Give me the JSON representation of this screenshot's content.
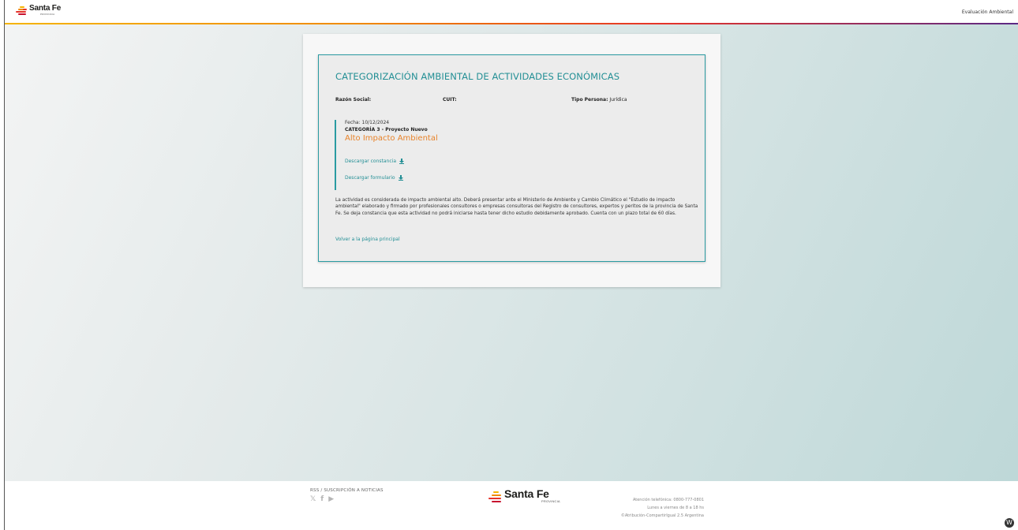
{
  "header": {
    "brand": "Santa Fe",
    "brand_sub": "PROVINCIA",
    "nav_link": "Evaluación Ambiental"
  },
  "main": {
    "title": "CATEGORIZACIÓN AMBIENTAL DE ACTIVIDADES ECONÓMICAS",
    "fields": {
      "razon_social_label": "Razón Social:",
      "razon_social_value": "",
      "cuit_label": "CUIT:",
      "cuit_value": "",
      "tipo_persona_label": "Tipo Persona:",
      "tipo_persona_value": "Jurídica"
    },
    "result": {
      "date": "Fecha: 10/12/2024",
      "category": "CATEGORÍA 3 - Proyecto Nuevo",
      "impact": "Alto Impacto Ambiental",
      "download_constancia": "Descargar constancia",
      "download_formulario": "Descargar formulario"
    },
    "description": "La actividad es considerada de impacto ambiental alto. Deberá presentar ante el Ministerio de Ambiente y Cambio Climático el \"Estudio de impacto ambiental\" elaborado y firmado por profesionales consultores o empresas consultoras del Registro de consultores, expertos y peritos de la provincia de Santa Fe. Se deja constancia que esta actividad no podrá iniciarse hasta tener dicho estudio debidamente aprobado. Cuenta con un plazo total de 60 días.",
    "back_link": "Volver a la página principal"
  },
  "footer": {
    "rss": "RSS / SUSCRIPCIÓN A NOTICIAS",
    "brand": "Santa Fe",
    "brand_sub": "PROVINCIA",
    "phone": "Atención telefónica: 0800-777-0801",
    "hours": "Lunes a viernes de 8 a 18 hs",
    "license": "©Atribución-CompartirIgual 2.5 Argentina"
  },
  "colors": {
    "accent": "#238f95",
    "impact": "#e8832a"
  },
  "icons": [
    "santa-fe-logo-icon",
    "download-icon",
    "twitter-icon",
    "facebook-icon",
    "youtube-icon",
    "wordpress-icon"
  ]
}
